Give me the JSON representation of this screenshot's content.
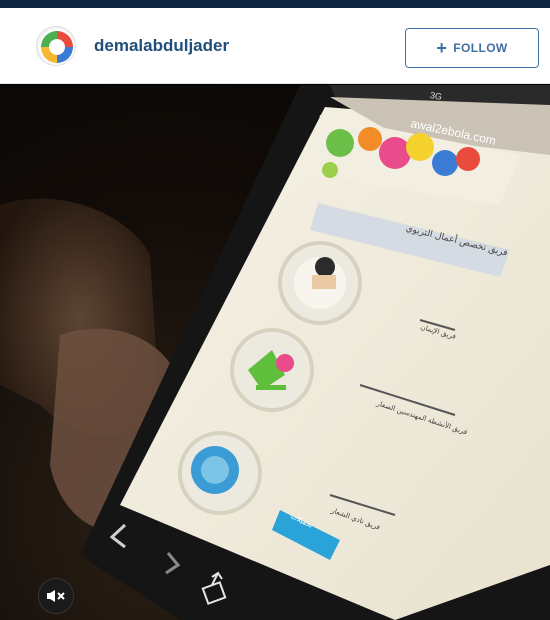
{
  "header": {
    "username": "demalabduljader",
    "follow_label": "FOLLOW"
  },
  "phone_screen": {
    "url": "awal2ebola.com",
    "status_network": "3G",
    "banner_text": "فريق تخصص أعمال التربوي",
    "items": [
      {
        "label": "فريق الإيمان"
      },
      {
        "label": "فريق الأنشطة المهندسين الصغار"
      },
      {
        "label": "فريق نادي الشعار"
      }
    ],
    "button_label": "تحميلات"
  },
  "icons": {
    "mute": "speaker-muted-icon",
    "share": "share-icon",
    "back": "chevron-left-icon",
    "forward": "chevron-right-icon",
    "follow": "plus-icon"
  },
  "colors": {
    "username": "#1f4f7a",
    "follow_border": "#3f6fa3",
    "topbar": "#0f2540",
    "phone_button": "#2aa3d8"
  }
}
